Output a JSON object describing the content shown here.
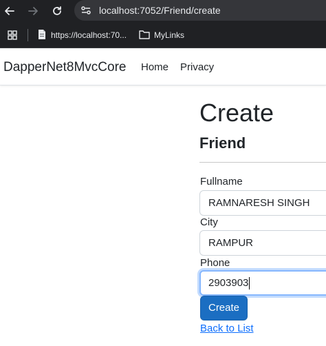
{
  "browser": {
    "url": "localhost:7052/Friend/create",
    "bookmarks": [
      {
        "label": "https://localhost:70...",
        "icon": "page-icon"
      },
      {
        "label": "MyLinks",
        "icon": "folder-icon"
      }
    ]
  },
  "navbar": {
    "brand": "DapperNet8MvcCore",
    "links": [
      "Home",
      "Privacy"
    ]
  },
  "page": {
    "title": "Create",
    "subtitle": "Friend"
  },
  "form": {
    "fullname": {
      "label": "Fullname",
      "value": "RAMNARESH SINGH"
    },
    "city": {
      "label": "City",
      "value": "RAMPUR"
    },
    "phone": {
      "label": "Phone",
      "value": "2903903"
    },
    "submit_label": "Create",
    "back_label": "Back to List"
  },
  "colors": {
    "chrome_bg": "#202124",
    "primary_button": "#1b6ec2",
    "link": "#0d6efd",
    "focus_ring": "#86b7fe"
  }
}
